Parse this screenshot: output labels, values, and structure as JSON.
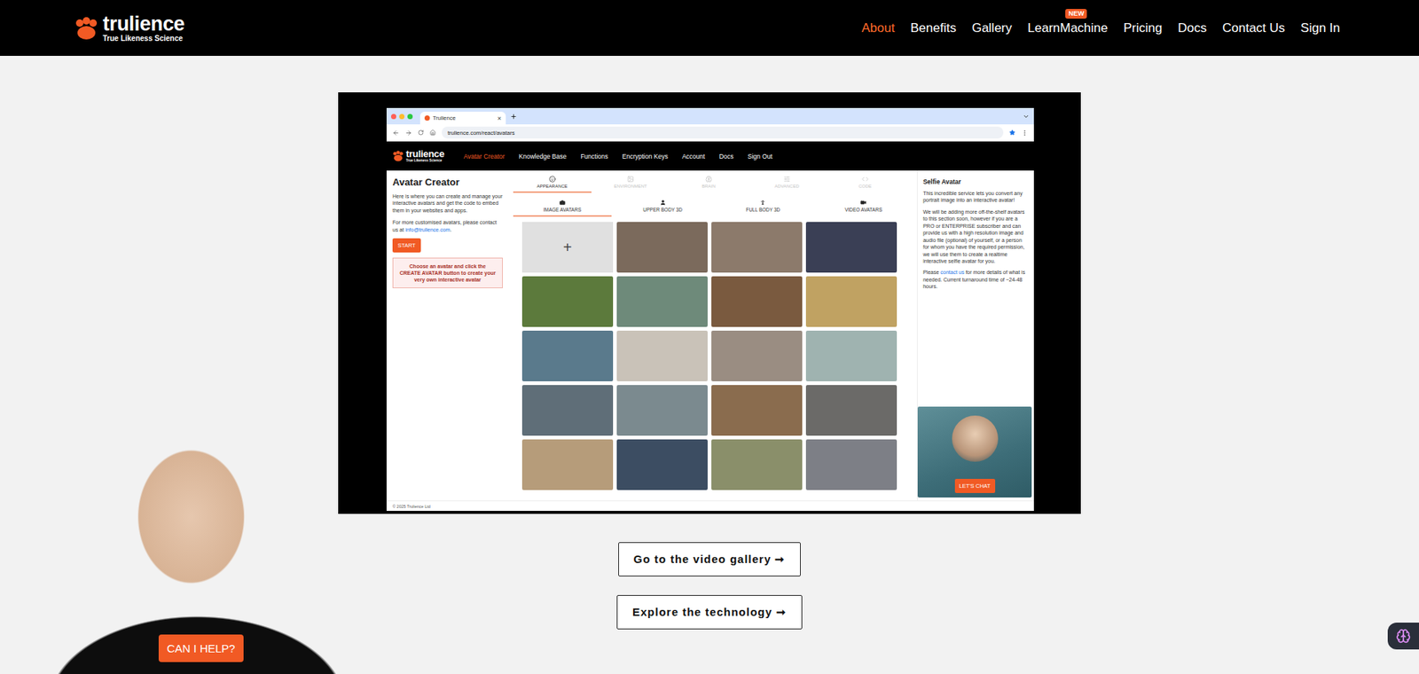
{
  "header": {
    "logo": {
      "name": "trulience",
      "tagline": "True Likeness Science"
    },
    "nav": [
      {
        "label": "About",
        "selected": true,
        "badge": ""
      },
      {
        "label": "Benefits",
        "selected": false,
        "badge": ""
      },
      {
        "label": "Gallery",
        "selected": false,
        "badge": ""
      },
      {
        "label": "LearnMachine",
        "selected": false,
        "badge": "NEW"
      },
      {
        "label": "Pricing",
        "selected": false,
        "badge": ""
      },
      {
        "label": "Docs",
        "selected": false,
        "badge": ""
      },
      {
        "label": "Contact Us",
        "selected": false,
        "badge": ""
      },
      {
        "label": "Sign In",
        "selected": false,
        "badge": ""
      }
    ]
  },
  "video": {
    "browser": {
      "tab": "Trulience",
      "close": "×",
      "url": "trulience.com/react/avatars"
    },
    "app": {
      "logo": {
        "name": "trulience",
        "tagline": "True Likeness Science"
      },
      "nav": [
        {
          "label": "Avatar Creator",
          "selected": true
        },
        {
          "label": "Knowledge Base",
          "selected": false
        },
        {
          "label": "Functions",
          "selected": false
        },
        {
          "label": "Encryption Keys",
          "selected": false
        },
        {
          "label": "Account",
          "selected": false
        },
        {
          "label": "Docs",
          "selected": false
        },
        {
          "label": "Sign Out",
          "selected": false
        }
      ],
      "sidebar": {
        "title": "Avatar Creator",
        "description": "Here is where you can create and manage your interactive avatars and get the code to embed them in your websites and apps.",
        "contact_text": "For more customised avatars, please contact us at ",
        "contact_link": "info@trulience.com",
        "contact_end": ".",
        "start_button": "START",
        "notice": "Choose an avatar and click the CREATE AVATAR button to create your very own interactive avatar"
      },
      "tabs": [
        {
          "label": "APPEARANCE",
          "selected": true,
          "disabled": false
        },
        {
          "label": "ENVIRONMENT",
          "selected": false,
          "disabled": true
        },
        {
          "label": "BRAIN",
          "selected": false,
          "disabled": true
        },
        {
          "label": "ADVANCED",
          "selected": false,
          "disabled": true
        },
        {
          "label": "CODE",
          "selected": false,
          "disabled": true
        }
      ],
      "subtabs": [
        {
          "label": "IMAGE AVATARS",
          "selected": true
        },
        {
          "label": "UPPER BODY 3D",
          "selected": false
        },
        {
          "label": "FULL BODY 3D",
          "selected": false
        },
        {
          "label": "VIDEO AVATARS",
          "selected": false
        }
      ],
      "cells": [
        {
          "kind": "add",
          "label": "+"
        },
        {
          "kind": "photo"
        },
        {
          "kind": "photo"
        },
        {
          "kind": "photo"
        },
        {
          "kind": "photo"
        },
        {
          "kind": "photo"
        },
        {
          "kind": "photo"
        },
        {
          "kind": "photo"
        },
        {
          "kind": "photo"
        },
        {
          "kind": "photo"
        },
        {
          "kind": "photo"
        },
        {
          "kind": "photo"
        },
        {
          "kind": "photo"
        },
        {
          "kind": "photo"
        },
        {
          "kind": "photo"
        },
        {
          "kind": "photo"
        },
        {
          "kind": "photo"
        },
        {
          "kind": "photo"
        },
        {
          "kind": "photo"
        },
        {
          "kind": "photo"
        }
      ],
      "info": {
        "title": "Selfie Avatar",
        "p1": "This incredible service lets you convert any portrait image into an interactive avatar!",
        "p2": "We will be adding more off-the-shelf avatars to this section soon, however if you are a PRO or ENTERPRISE subscriber and can provide us with a high resolution image and audio file (optional) of yourself, or a person for whom you have the required permission, we will use them to create a realtime interactive selfie avatar for you.",
        "p3_start": "Please ",
        "p3_link": "contact us",
        "p3_end": " for more details of what is needed. Current turnaround time of ~24-48 hours."
      },
      "preview": {
        "button": "LET'S CHAT"
      },
      "footer": "© 2025 Trulience Ltd"
    }
  },
  "buttons": [
    "Go to the video gallery ➞",
    "Explore the technology ➞"
  ],
  "assistant": {
    "button": "CAN I HELP?"
  }
}
